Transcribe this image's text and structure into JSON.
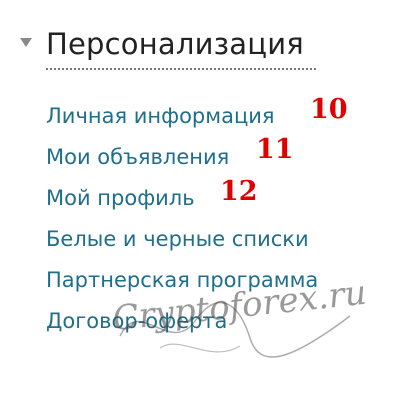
{
  "section": {
    "title": "Персонализация"
  },
  "menu": {
    "items": [
      {
        "label": "Личная информация"
      },
      {
        "label": "Мои объявления"
      },
      {
        "label": "Мой профиль"
      },
      {
        "label": "Белые и черные списки"
      },
      {
        "label": "Партнерская программа"
      },
      {
        "label": "Договор-оферта"
      }
    ]
  },
  "annotations": [
    "10",
    "11",
    "12"
  ],
  "watermark": {
    "text": "Cryptoforex.ru"
  },
  "colors": {
    "link": "#1f6f8b",
    "annotation": "#e00000",
    "title": "#222222"
  }
}
